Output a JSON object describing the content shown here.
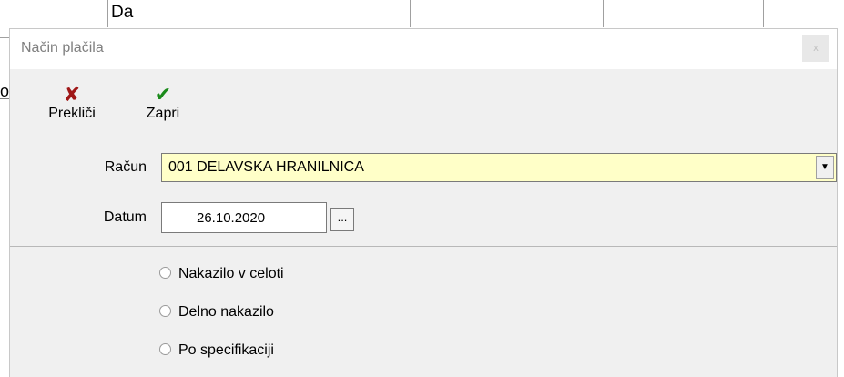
{
  "background": {
    "header_text": "Da",
    "left_char": "o"
  },
  "dialog": {
    "title": "Način plačila",
    "close_label": "x"
  },
  "toolbar": {
    "cancel_label": "Prekliči",
    "close_label": "Zapri",
    "cancel_icon": "x-icon",
    "close_icon": "checkmark-icon"
  },
  "form": {
    "account_label": "Račun",
    "account_value": "001  DELAVSKA HRANILNICA",
    "date_label": "Datum",
    "date_value": "26.10.2020",
    "date_button": "..."
  },
  "options": [
    {
      "label": "Nakazilo v celoti"
    },
    {
      "label": "Delno nakazilo"
    },
    {
      "label": "Po specifikaciji"
    }
  ],
  "colors": {
    "combo_bg": "#ffffc8",
    "cancel_icon": "#a01818",
    "close_icon": "#1a8a1a"
  }
}
